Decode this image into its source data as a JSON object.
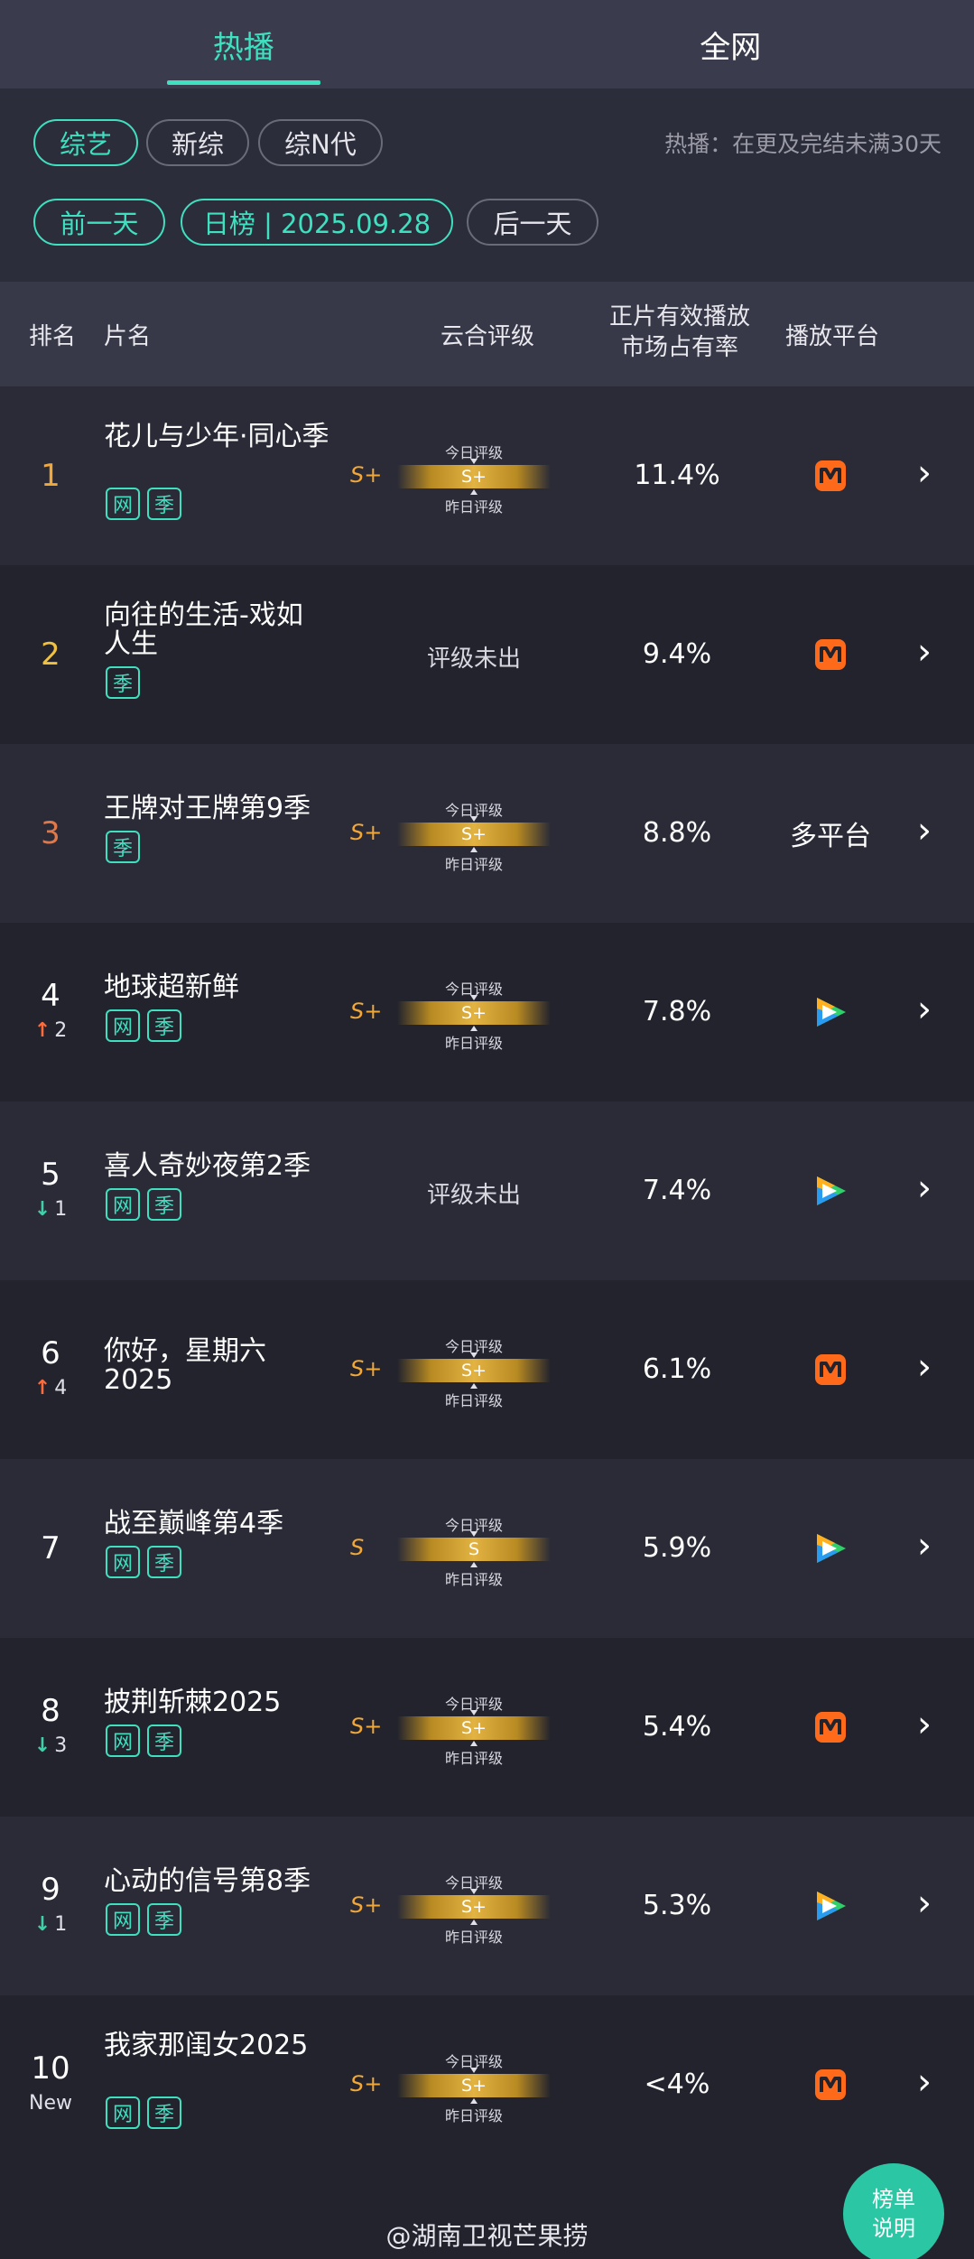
{
  "tabs": {
    "hot": "热播",
    "all": "全网"
  },
  "filters": {
    "chips": [
      "综艺",
      "新综",
      "综N代"
    ],
    "hint": "热播：在更及完结未满30天",
    "prev_day": "前一天",
    "date": "日榜 | 2025.09.28",
    "next_day": "后一天"
  },
  "table_header": {
    "rank": "排名",
    "title": "片名",
    "rating": "云合评级",
    "share_line1": "正片有效播放",
    "share_line2": "市场占有率",
    "platform": "播放平台"
  },
  "gauge_labels": {
    "today": "今日评级",
    "yesterday": "昨日评级"
  },
  "rows": [
    {
      "rank": "1",
      "rank_color": "#f0a83a",
      "change": "",
      "dir": "",
      "title": "花儿与少年·同心季",
      "tags": [
        "网",
        "季"
      ],
      "grade_letter": "S+",
      "grade": "S+",
      "share": "11.4%",
      "platform": "mango"
    },
    {
      "rank": "2",
      "rank_color": "#f0c040",
      "change": "",
      "dir": "",
      "title": "向往的生活-戏如人生",
      "tags": [
        "季"
      ],
      "grade_letter": "",
      "grade": "评级未出",
      "share": "9.4%",
      "platform": "mango"
    },
    {
      "rank": "3",
      "rank_color": "#e0784a",
      "change": "",
      "dir": "",
      "title": "王牌对王牌第9季",
      "tags": [
        "季"
      ],
      "grade_letter": "S+",
      "grade": "S+",
      "share": "8.8%",
      "platform": "多平台"
    },
    {
      "rank": "4",
      "rank_color": "#ffffff",
      "change": "2",
      "dir": "up",
      "title": "地球超新鲜",
      "tags": [
        "网",
        "季"
      ],
      "grade_letter": "S+",
      "grade": "S+",
      "share": "7.8%",
      "platform": "tencent"
    },
    {
      "rank": "5",
      "rank_color": "#ffffff",
      "change": "1",
      "dir": "down",
      "title": "喜人奇妙夜第2季",
      "tags": [
        "网",
        "季"
      ],
      "grade_letter": "",
      "grade": "评级未出",
      "share": "7.4%",
      "platform": "tencent"
    },
    {
      "rank": "6",
      "rank_color": "#ffffff",
      "change": "4",
      "dir": "up",
      "title": "你好，星期六2025",
      "tags": [],
      "grade_letter": "S+",
      "grade": "S+",
      "share": "6.1%",
      "platform": "mango"
    },
    {
      "rank": "7",
      "rank_color": "#ffffff",
      "change": "",
      "dir": "",
      "title": "战至巅峰第4季",
      "tags": [
        "网",
        "季"
      ],
      "grade_letter": "S",
      "grade": "S",
      "share": "5.9%",
      "platform": "tencent"
    },
    {
      "rank": "8",
      "rank_color": "#ffffff",
      "change": "3",
      "dir": "down",
      "title": "披荆斩棘2025",
      "tags": [
        "网",
        "季"
      ],
      "grade_letter": "S+",
      "grade": "S+",
      "share": "5.4%",
      "platform": "mango"
    },
    {
      "rank": "9",
      "rank_color": "#ffffff",
      "change": "1",
      "dir": "down",
      "title": "心动的信号第8季",
      "tags": [
        "网",
        "季"
      ],
      "grade_letter": "S+",
      "grade": "S+",
      "share": "5.3%",
      "platform": "tencent"
    },
    {
      "rank": "10",
      "rank_color": "#ffffff",
      "change": "New",
      "dir": "new",
      "title": "我家那闺女2025",
      "tags": [
        "网",
        "季"
      ],
      "grade_letter": "S+",
      "grade": "S+",
      "share": "<4%",
      "platform": "mango"
    }
  ],
  "icons": {
    "chevron": "chevron-right-icon",
    "mango": "mango-tv-logo",
    "tencent": "tencent-video-logo",
    "up": "arrow-up-icon",
    "down": "arrow-down-icon"
  },
  "colors": {
    "accent": "#3fe0c0",
    "gold": "#e2b342",
    "up": "#ff6a3a",
    "down": "#3fd0a8"
  },
  "footer": {
    "watermark": "@湖南卫视芒果捞",
    "fab_line1": "榜单",
    "fab_line2": "说明"
  }
}
